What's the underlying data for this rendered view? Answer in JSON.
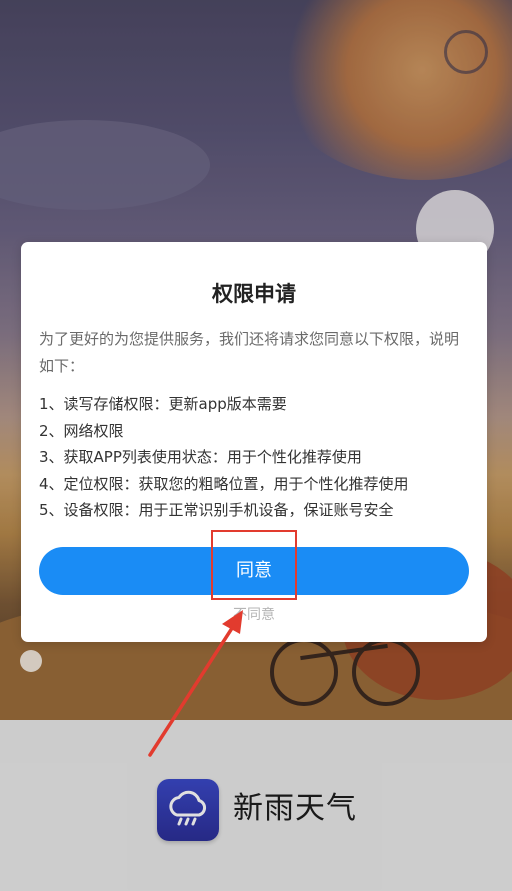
{
  "dialog": {
    "title": "权限申请",
    "intro": "为了更好的为您提供服务，我们还将请求您同意以下权限，说明如下：",
    "permissions": [
      "1、读写存储权限：更新app版本需要",
      "2、网络权限",
      "3、获取APP列表使用状态：用于个性化推荐使用",
      "4、定位权限：获取您的粗略位置，用于个性化推荐使用",
      "5、设备权限：用于正常识别手机设备，保证账号安全"
    ],
    "agree_label": "同意",
    "disagree_label": "不同意"
  },
  "brand": {
    "app_name": "新雨天气",
    "logo_icon": "rain-cloud-icon"
  },
  "colors": {
    "primary_button": "#1a8cf5",
    "annotation": "#e23b2e",
    "logo": "#3b49c8"
  }
}
